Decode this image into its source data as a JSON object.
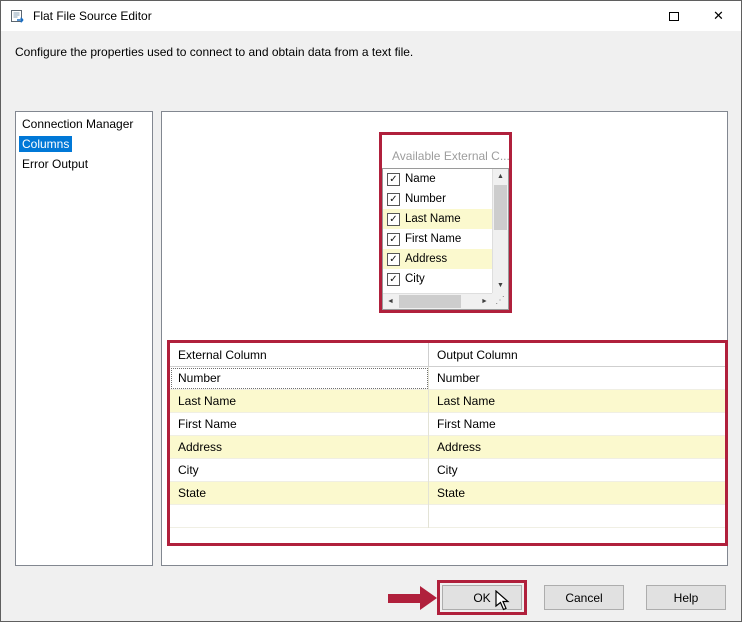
{
  "window": {
    "title": "Flat File Source Editor",
    "description": "Configure the properties used to connect to and obtain data from a text file."
  },
  "icons": {
    "close": "✕",
    "check": "✓",
    "arrow_up": "▲",
    "arrow_down": "▼",
    "arrow_left": "◄",
    "arrow_right": "►",
    "resize_grip": "⋰"
  },
  "sidebar": {
    "items": [
      {
        "label": "Connection Manager",
        "selected": false
      },
      {
        "label": "Columns",
        "selected": true
      },
      {
        "label": "Error Output",
        "selected": false
      }
    ]
  },
  "available_columns": {
    "header": "Available External C...",
    "items": [
      {
        "label": "Name",
        "checked": true,
        "highlighted": false
      },
      {
        "label": "Number",
        "checked": true,
        "highlighted": false
      },
      {
        "label": "Last Name",
        "checked": true,
        "highlighted": true
      },
      {
        "label": "First Name",
        "checked": true,
        "highlighted": false
      },
      {
        "label": "Address",
        "checked": true,
        "highlighted": true
      },
      {
        "label": "City",
        "checked": true,
        "highlighted": false
      }
    ]
  },
  "mapping_table": {
    "headers": [
      "External Column",
      "Output Column"
    ],
    "rows": [
      {
        "external": "Number",
        "output": "Number",
        "highlighted": false,
        "focused": true
      },
      {
        "external": "Last Name",
        "output": "Last Name",
        "highlighted": true,
        "focused": false
      },
      {
        "external": "First Name",
        "output": "First Name",
        "highlighted": false,
        "focused": false
      },
      {
        "external": "Address",
        "output": "Address",
        "highlighted": true,
        "focused": false
      },
      {
        "external": "City",
        "output": "City",
        "highlighted": false,
        "focused": false
      },
      {
        "external": "State",
        "output": "State",
        "highlighted": true,
        "focused": false
      }
    ]
  },
  "buttons": {
    "ok": "OK",
    "cancel": "Cancel",
    "help": "Help"
  },
  "colors": {
    "selection_blue": "#0078d7",
    "annotation_red": "#b0203c",
    "highlight_yellow": "#fbf9ce"
  }
}
